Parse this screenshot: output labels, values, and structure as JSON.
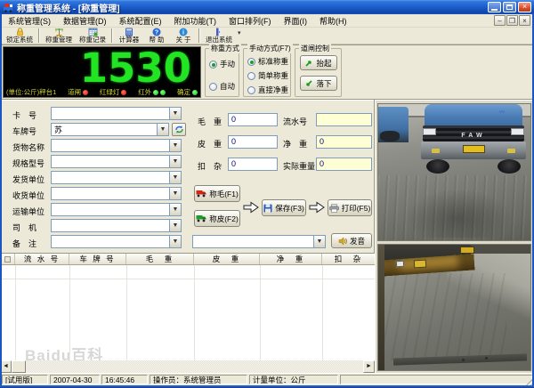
{
  "window": {
    "title": "称重管理系统 - [称重管理]"
  },
  "menu": {
    "items": [
      "系统管理(S)",
      "数据管理(D)",
      "系统配置(E)",
      "附加功能(T)",
      "窗口排列(F)",
      "界面(I)",
      "帮助(H)"
    ]
  },
  "toolbar": {
    "buttons": [
      {
        "label": "锁定系统",
        "icon": "lock-icon"
      },
      {
        "label": "称重管理",
        "icon": "scale-icon"
      },
      {
        "label": "称重记录",
        "icon": "records-grid-icon"
      },
      {
        "label": "计算器",
        "icon": "calculator-icon"
      },
      {
        "label": "帮 助",
        "icon": "help-icon"
      },
      {
        "label": "关 于",
        "icon": "about-icon"
      },
      {
        "label": "退出系统",
        "icon": "exit-icon"
      }
    ]
  },
  "led_display": {
    "value": "1530",
    "platform_label": "(单位:公斤)秤台1",
    "digit_color": "#22e422",
    "indicators": [
      {
        "label": "道闸",
        "dots": [
          "red"
        ]
      },
      {
        "label": "红绿灯",
        "dots": [
          "red"
        ]
      },
      {
        "label": "红外",
        "dots": [
          "green",
          "green"
        ]
      },
      {
        "label": "确定",
        "dots": [
          "green"
        ]
      }
    ]
  },
  "weigh_mode_group": {
    "title": "称重方式",
    "options": [
      {
        "label": "手动",
        "selected": true
      },
      {
        "label": "自动",
        "selected": false
      }
    ]
  },
  "manual_mode_group": {
    "title": "手动方式(F7)",
    "options": [
      {
        "label": "标准称重",
        "selected": true
      },
      {
        "label": "简单称重",
        "selected": false
      },
      {
        "label": "直接净重",
        "selected": false
      }
    ]
  },
  "gate_group": {
    "title": "道闸控制",
    "lift_label": "抬起",
    "drop_label": "落下"
  },
  "form": {
    "fields": [
      {
        "label": "卡　号",
        "value": ""
      },
      {
        "label": "车牌号",
        "value": "苏"
      },
      {
        "label": "货物名称",
        "value": ""
      },
      {
        "label": "规格型号",
        "value": ""
      },
      {
        "label": "发货单位",
        "value": ""
      },
      {
        "label": "收货单位",
        "value": ""
      },
      {
        "label": "运输单位",
        "value": ""
      },
      {
        "label": "司　机",
        "value": ""
      },
      {
        "label": "备　注",
        "value": ""
      }
    ]
  },
  "weights": {
    "gross": {
      "label": "毛　重",
      "value": "0"
    },
    "tare": {
      "label": "皮　重",
      "value": "0"
    },
    "deduction": {
      "label": "扣　杂",
      "value": "0"
    },
    "serial": {
      "label": "流水号",
      "value": ""
    },
    "net": {
      "label": "净　重",
      "value": "0"
    },
    "actual": {
      "label": "实际重量",
      "value": "0"
    }
  },
  "actions": {
    "weigh_gross": "称毛(F1)",
    "weigh_tare": "称皮(F2)",
    "save": "保存(F3)",
    "print": "打印(F5)",
    "voice": "发音",
    "voice_text": ""
  },
  "table": {
    "columns": [
      "流 水 号",
      "车 牌 号",
      "毛　重",
      "皮　重",
      "净　重",
      "扣　杂"
    ]
  },
  "statusbar": {
    "panels": [
      "[试用版]",
      "2007-04-30",
      "16:45:46",
      "操作员：系统管理员",
      "计量单位：公斤"
    ]
  },
  "cameras": {
    "top_truck_brand": "FAW"
  },
  "watermark": "Baidu百科",
  "colors": {
    "titlebar": "#1e5fd0",
    "led_green": "#22e422",
    "panel_bg": "#ece9d8",
    "field_yellow": "#ffffd6"
  }
}
